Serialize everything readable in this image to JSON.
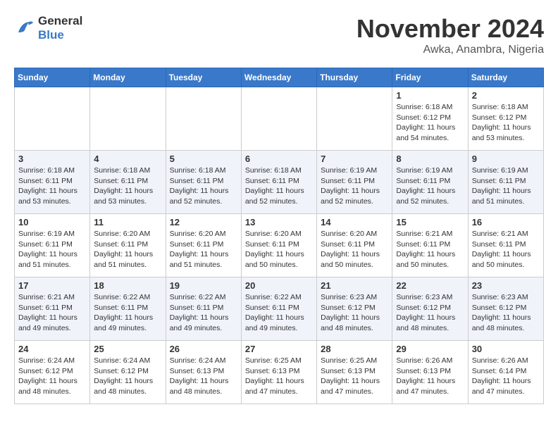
{
  "logo": {
    "line1": "General",
    "line2": "Blue"
  },
  "title": "November 2024",
  "location": "Awka, Anambra, Nigeria",
  "weekdays": [
    "Sunday",
    "Monday",
    "Tuesday",
    "Wednesday",
    "Thursday",
    "Friday",
    "Saturday"
  ],
  "weeks": [
    [
      {
        "day": "",
        "detail": ""
      },
      {
        "day": "",
        "detail": ""
      },
      {
        "day": "",
        "detail": ""
      },
      {
        "day": "",
        "detail": ""
      },
      {
        "day": "",
        "detail": ""
      },
      {
        "day": "1",
        "detail": "Sunrise: 6:18 AM\nSunset: 6:12 PM\nDaylight: 11 hours\nand 54 minutes."
      },
      {
        "day": "2",
        "detail": "Sunrise: 6:18 AM\nSunset: 6:12 PM\nDaylight: 11 hours\nand 53 minutes."
      }
    ],
    [
      {
        "day": "3",
        "detail": "Sunrise: 6:18 AM\nSunset: 6:11 PM\nDaylight: 11 hours\nand 53 minutes."
      },
      {
        "day": "4",
        "detail": "Sunrise: 6:18 AM\nSunset: 6:11 PM\nDaylight: 11 hours\nand 53 minutes."
      },
      {
        "day": "5",
        "detail": "Sunrise: 6:18 AM\nSunset: 6:11 PM\nDaylight: 11 hours\nand 52 minutes."
      },
      {
        "day": "6",
        "detail": "Sunrise: 6:18 AM\nSunset: 6:11 PM\nDaylight: 11 hours\nand 52 minutes."
      },
      {
        "day": "7",
        "detail": "Sunrise: 6:19 AM\nSunset: 6:11 PM\nDaylight: 11 hours\nand 52 minutes."
      },
      {
        "day": "8",
        "detail": "Sunrise: 6:19 AM\nSunset: 6:11 PM\nDaylight: 11 hours\nand 52 minutes."
      },
      {
        "day": "9",
        "detail": "Sunrise: 6:19 AM\nSunset: 6:11 PM\nDaylight: 11 hours\nand 51 minutes."
      }
    ],
    [
      {
        "day": "10",
        "detail": "Sunrise: 6:19 AM\nSunset: 6:11 PM\nDaylight: 11 hours\nand 51 minutes."
      },
      {
        "day": "11",
        "detail": "Sunrise: 6:20 AM\nSunset: 6:11 PM\nDaylight: 11 hours\nand 51 minutes."
      },
      {
        "day": "12",
        "detail": "Sunrise: 6:20 AM\nSunset: 6:11 PM\nDaylight: 11 hours\nand 51 minutes."
      },
      {
        "day": "13",
        "detail": "Sunrise: 6:20 AM\nSunset: 6:11 PM\nDaylight: 11 hours\nand 50 minutes."
      },
      {
        "day": "14",
        "detail": "Sunrise: 6:20 AM\nSunset: 6:11 PM\nDaylight: 11 hours\nand 50 minutes."
      },
      {
        "day": "15",
        "detail": "Sunrise: 6:21 AM\nSunset: 6:11 PM\nDaylight: 11 hours\nand 50 minutes."
      },
      {
        "day": "16",
        "detail": "Sunrise: 6:21 AM\nSunset: 6:11 PM\nDaylight: 11 hours\nand 50 minutes."
      }
    ],
    [
      {
        "day": "17",
        "detail": "Sunrise: 6:21 AM\nSunset: 6:11 PM\nDaylight: 11 hours\nand 49 minutes."
      },
      {
        "day": "18",
        "detail": "Sunrise: 6:22 AM\nSunset: 6:11 PM\nDaylight: 11 hours\nand 49 minutes."
      },
      {
        "day": "19",
        "detail": "Sunrise: 6:22 AM\nSunset: 6:11 PM\nDaylight: 11 hours\nand 49 minutes."
      },
      {
        "day": "20",
        "detail": "Sunrise: 6:22 AM\nSunset: 6:11 PM\nDaylight: 11 hours\nand 49 minutes."
      },
      {
        "day": "21",
        "detail": "Sunrise: 6:23 AM\nSunset: 6:12 PM\nDaylight: 11 hours\nand 48 minutes."
      },
      {
        "day": "22",
        "detail": "Sunrise: 6:23 AM\nSunset: 6:12 PM\nDaylight: 11 hours\nand 48 minutes."
      },
      {
        "day": "23",
        "detail": "Sunrise: 6:23 AM\nSunset: 6:12 PM\nDaylight: 11 hours\nand 48 minutes."
      }
    ],
    [
      {
        "day": "24",
        "detail": "Sunrise: 6:24 AM\nSunset: 6:12 PM\nDaylight: 11 hours\nand 48 minutes."
      },
      {
        "day": "25",
        "detail": "Sunrise: 6:24 AM\nSunset: 6:12 PM\nDaylight: 11 hours\nand 48 minutes."
      },
      {
        "day": "26",
        "detail": "Sunrise: 6:24 AM\nSunset: 6:13 PM\nDaylight: 11 hours\nand 48 minutes."
      },
      {
        "day": "27",
        "detail": "Sunrise: 6:25 AM\nSunset: 6:13 PM\nDaylight: 11 hours\nand 47 minutes."
      },
      {
        "day": "28",
        "detail": "Sunrise: 6:25 AM\nSunset: 6:13 PM\nDaylight: 11 hours\nand 47 minutes."
      },
      {
        "day": "29",
        "detail": "Sunrise: 6:26 AM\nSunset: 6:13 PM\nDaylight: 11 hours\nand 47 minutes."
      },
      {
        "day": "30",
        "detail": "Sunrise: 6:26 AM\nSunset: 6:14 PM\nDaylight: 11 hours\nand 47 minutes."
      }
    ]
  ]
}
